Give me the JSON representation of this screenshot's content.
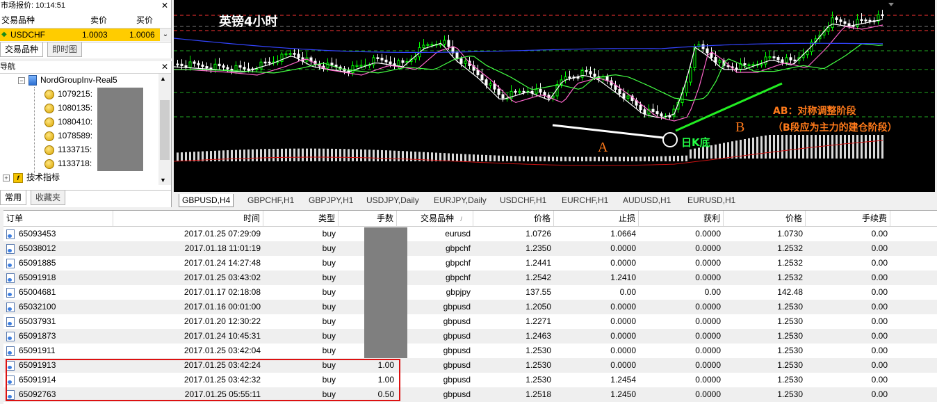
{
  "market_watch": {
    "title": "市场报价: 10:14:51",
    "col_symbol": "交易品种",
    "col_bid": "卖价",
    "col_ask": "买价",
    "row": {
      "symbol": "USDCHF",
      "bid": "1.0003",
      "ask": "1.0006"
    },
    "tabs": [
      "交易品种",
      "即时图"
    ]
  },
  "navigator": {
    "title": "导航",
    "server": "NordGroupInv-Real5",
    "accounts": [
      "1079215:",
      "1080135:",
      "1080410:",
      "1078589:",
      "1133715:",
      "1133718:"
    ],
    "indicators": "技术指标",
    "tabs": [
      "常用",
      "收藏夹"
    ]
  },
  "chart": {
    "title": "英镑4小时",
    "label_a": "A",
    "label_b": "B",
    "label_daily_low": "日K底",
    "note_line1": "AB：对称调整阶段",
    "note_line2": "（B段应为主力的建仓阶段）",
    "colors": {
      "bull": "#00ff00",
      "bear": "#ffffff",
      "annotation": "#ff7a1a",
      "green_label": "#22ff44"
    }
  },
  "chart_tabs": [
    "GBPUSD,H4",
    "GBPCHF,H1",
    "GBPJPY,H1",
    "USDJPY,Daily",
    "EURJPY,Daily",
    "USDCHF,H1",
    "EURCHF,H1",
    "AUDUSD,H1",
    "EURUSD,H1"
  ],
  "orders": {
    "headers": [
      "订单",
      "时间",
      "类型",
      "手数",
      "交易品种",
      "价格",
      "止损",
      "获利",
      "价格",
      "手续费"
    ],
    "sort_mark": "/",
    "rows": [
      {
        "id": "65093453",
        "time": "2017.01.25 07:29:09",
        "type": "buy",
        "lots": "",
        "symbol": "eurusd",
        "price": "1.0726",
        "sl": "1.0664",
        "tp": "0.0000",
        "cur": "1.0730",
        "fee": "0.00"
      },
      {
        "id": "65038012",
        "time": "2017.01.18 11:01:19",
        "type": "buy",
        "lots": "",
        "symbol": "gbpchf",
        "price": "1.2350",
        "sl": "0.0000",
        "tp": "0.0000",
        "cur": "1.2532",
        "fee": "0.00"
      },
      {
        "id": "65091885",
        "time": "2017.01.24 14:27:48",
        "type": "buy",
        "lots": "",
        "symbol": "gbpchf",
        "price": "1.2441",
        "sl": "0.0000",
        "tp": "0.0000",
        "cur": "1.2532",
        "fee": "0.00"
      },
      {
        "id": "65091918",
        "time": "2017.01.25 03:43:02",
        "type": "buy",
        "lots": "",
        "symbol": "gbpchf",
        "price": "1.2542",
        "sl": "1.2410",
        "tp": "0.0000",
        "cur": "1.2532",
        "fee": "0.00"
      },
      {
        "id": "65004681",
        "time": "2017.01.17 02:18:08",
        "type": "buy",
        "lots": "",
        "symbol": "gbpjpy",
        "price": "137.55",
        "sl": "0.00",
        "tp": "0.00",
        "cur": "142.48",
        "fee": "0.00"
      },
      {
        "id": "65032100",
        "time": "2017.01.16 00:01:00",
        "type": "buy",
        "lots": "",
        "symbol": "gbpusd",
        "price": "1.2050",
        "sl": "0.0000",
        "tp": "0.0000",
        "cur": "1.2530",
        "fee": "0.00"
      },
      {
        "id": "65037931",
        "time": "2017.01.20 12:30:22",
        "type": "buy",
        "lots": "",
        "symbol": "gbpusd",
        "price": "1.2271",
        "sl": "0.0000",
        "tp": "0.0000",
        "cur": "1.2530",
        "fee": "0.00"
      },
      {
        "id": "65091873",
        "time": "2017.01.24 10:45:31",
        "type": "buy",
        "lots": "",
        "symbol": "gbpusd",
        "price": "1.2463",
        "sl": "0.0000",
        "tp": "0.0000",
        "cur": "1.2530",
        "fee": "0.00"
      },
      {
        "id": "65091911",
        "time": "2017.01.25 03:42:04",
        "type": "buy",
        "lots": "",
        "symbol": "gbpusd",
        "price": "1.2530",
        "sl": "0.0000",
        "tp": "0.0000",
        "cur": "1.2530",
        "fee": "0.00"
      },
      {
        "id": "65091913",
        "time": "2017.01.25 03:42:24",
        "type": "buy",
        "lots": "1.00",
        "symbol": "gbpusd",
        "price": "1.2530",
        "sl": "0.0000",
        "tp": "0.0000",
        "cur": "1.2530",
        "fee": "0.00"
      },
      {
        "id": "65091914",
        "time": "2017.01.25 03:42:32",
        "type": "buy",
        "lots": "1.00",
        "symbol": "gbpusd",
        "price": "1.2530",
        "sl": "1.2454",
        "tp": "0.0000",
        "cur": "1.2530",
        "fee": "0.00"
      },
      {
        "id": "65092763",
        "time": "2017.01.25 05:55:11",
        "type": "buy",
        "lots": "0.50",
        "symbol": "gbpusd",
        "price": "1.2518",
        "sl": "1.2450",
        "tp": "0.0000",
        "cur": "1.2530",
        "fee": "0.00"
      }
    ]
  }
}
